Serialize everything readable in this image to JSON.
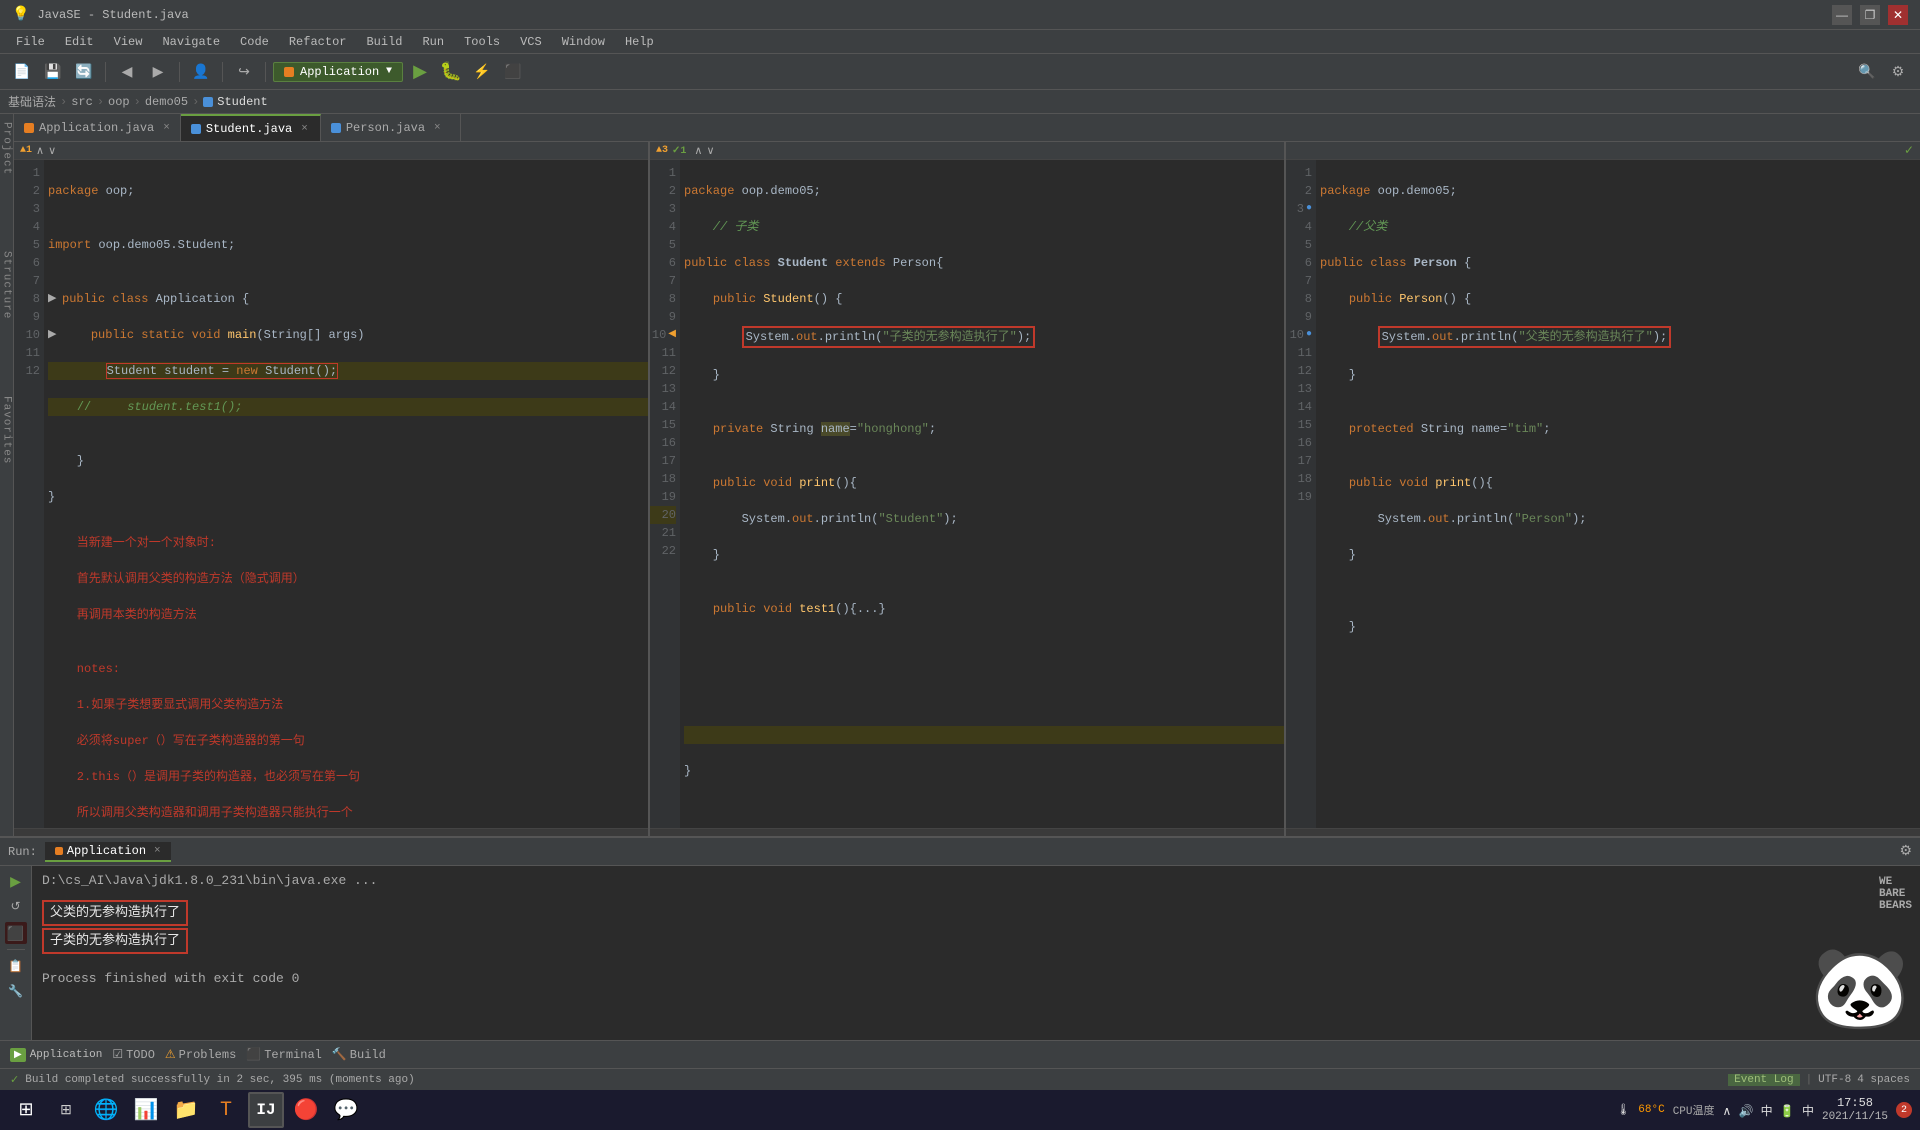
{
  "titlebar": {
    "title": "JavaSE - Student.java",
    "min": "—",
    "max": "❐",
    "close": "✕"
  },
  "menubar": {
    "items": [
      "File",
      "Edit",
      "View",
      "Navigate",
      "Code",
      "Refactor",
      "Build",
      "Run",
      "Tools",
      "VCS",
      "Window",
      "Help"
    ]
  },
  "toolbar": {
    "run_config": "Application",
    "run_arrow": "▼"
  },
  "breadcrumb": {
    "items": [
      "基础语法",
      "src",
      "oop",
      "demo05",
      "Student"
    ]
  },
  "tabs": {
    "left": [
      {
        "label": "Application.java",
        "active": false,
        "icon": "orange"
      },
      {
        "label": "×",
        "close": true
      }
    ],
    "center": [
      {
        "label": "Student.java",
        "active": true,
        "icon": "blue"
      },
      {
        "label": "×",
        "close": true
      }
    ],
    "right": [
      {
        "label": "Person.java",
        "active": false,
        "icon": "blue"
      },
      {
        "label": "×",
        "close": true
      }
    ]
  },
  "panel1": {
    "warnings": "▲1",
    "arrows": "∧ ∨",
    "code": [
      {
        "ln": "1",
        "text": "package oop;",
        "class": ""
      },
      {
        "ln": "2",
        "text": "",
        "class": ""
      },
      {
        "ln": "3",
        "text": "import oop.demo05.Student;",
        "class": ""
      },
      {
        "ln": "4",
        "text": "",
        "class": ""
      },
      {
        "ln": "5",
        "text": "public class Application {",
        "class": ""
      },
      {
        "ln": "6",
        "text": "    public static void main(String[] args)",
        "class": ""
      },
      {
        "ln": "7",
        "text": "        Student student = new Student();",
        "class": "hl-yellow"
      },
      {
        "ln": "8",
        "text": "    //      student.test1();",
        "class": "hl-yellow"
      },
      {
        "ln": "9",
        "text": "",
        "class": ""
      },
      {
        "ln": "10",
        "text": "    }",
        "class": ""
      },
      {
        "ln": "11",
        "text": "}",
        "class": ""
      },
      {
        "ln": "12",
        "text": "    当新建一个对一个对象时:",
        "class": "red"
      },
      {
        "ln": "",
        "text": "    首先默认调用父类的构造方法（隐式调用）",
        "class": "red"
      },
      {
        "ln": "",
        "text": "    再调用本类的构造方法",
        "class": "red"
      },
      {
        "ln": "",
        "text": "",
        "class": ""
      },
      {
        "ln": "",
        "text": "    notes:",
        "class": "red"
      },
      {
        "ln": "",
        "text": "    1.如果子类想要显式调用父类构造方法",
        "class": "red"
      },
      {
        "ln": "",
        "text": "    必须将super（）写在子类构造器的第一句",
        "class": "red"
      },
      {
        "ln": "",
        "text": "    2.this（）是调用子类的构造器，也必须写在第一句",
        "class": "red"
      },
      {
        "ln": "",
        "text": "    所以调用父类构造器和调用子类构造器只能执行一个",
        "class": "red"
      }
    ]
  },
  "panel2": {
    "warnings": "▲3 ✓1",
    "code": [
      {
        "ln": "1",
        "text": "package oop.demo05;"
      },
      {
        "ln": "2",
        "text": "    // 子类"
      },
      {
        "ln": "3",
        "text": "public class Student extends Person{"
      },
      {
        "ln": "4",
        "text": "    public Student() {"
      },
      {
        "ln": "5",
        "text": "        System.out.println(\"子类的无参构造执行了\");",
        "box": true
      },
      {
        "ln": "6",
        "text": "    }"
      },
      {
        "ln": "7",
        "text": ""
      },
      {
        "ln": "8",
        "text": "    private String name=\"honghong\";"
      },
      {
        "ln": "9",
        "text": ""
      },
      {
        "ln": "10",
        "text": "    public void print(){"
      },
      {
        "ln": "11",
        "text": "        System.out.println(\"Student\");"
      },
      {
        "ln": "12",
        "text": "    }"
      },
      {
        "ln": "13",
        "text": ""
      },
      {
        "ln": "14",
        "text": "    public void test1(){...}"
      },
      {
        "ln": "15",
        "text": ""
      },
      {
        "ln": "16",
        "text": ""
      },
      {
        "ln": "17",
        "text": ""
      },
      {
        "ln": "18",
        "text": ""
      },
      {
        "ln": "19",
        "text": ""
      },
      {
        "ln": "20",
        "text": "",
        "hl": "hl-yellow"
      },
      {
        "ln": "21",
        "text": "}"
      },
      {
        "ln": "22",
        "text": ""
      }
    ]
  },
  "panel3": {
    "code": [
      {
        "ln": "1",
        "text": "package oop.demo05;"
      },
      {
        "ln": "2",
        "text": "    //父类"
      },
      {
        "ln": "3",
        "text": "public class Person {"
      },
      {
        "ln": "4",
        "text": "    public Person() {"
      },
      {
        "ln": "5",
        "text": "        System.out.println(\"父类的无参构造执行了\");",
        "box": true
      },
      {
        "ln": "6",
        "text": "    }"
      },
      {
        "ln": "7",
        "text": ""
      },
      {
        "ln": "8",
        "text": "    protected String name=\"tim\";"
      },
      {
        "ln": "9",
        "text": ""
      },
      {
        "ln": "10",
        "text": "    public void print(){"
      },
      {
        "ln": "11",
        "text": "        System.out.println(\"Person\");"
      },
      {
        "ln": "12",
        "text": "    }"
      },
      {
        "ln": "13",
        "text": ""
      },
      {
        "ln": "14",
        "text": ""
      },
      {
        "ln": "15",
        "text": "    }"
      },
      {
        "ln": "16",
        "text": ""
      },
      {
        "ln": "17",
        "text": ""
      },
      {
        "ln": "18",
        "text": ""
      },
      {
        "ln": "19",
        "text": ""
      }
    ]
  },
  "run_panel": {
    "label": "Run:",
    "tab": "Application",
    "close": "×",
    "cmd": "D:\\cs_AI\\Java\\jdk1.8.0_231\\bin\\java.exe ...",
    "output1": "父类的无参构造执行了",
    "output2": "子类的无参构造执行了",
    "finish": "Process finished with exit code 0"
  },
  "status_bar": {
    "build_msg": "Build completed successfully in 2 sec, 395 ms (moments ago)",
    "event_log": "Event Log",
    "encoding": "UTF-8",
    "indent": "4 spaces",
    "line_info": ""
  },
  "taskbar": {
    "time": "17:58",
    "date": "2021/11/15",
    "temp": "68°C",
    "temp_label": "CPU温度"
  },
  "sidebar_labels": [
    "Project",
    "Structure",
    "Favorites"
  ],
  "icons": {
    "search": "🔍",
    "settings": "⚙",
    "run": "▶",
    "debug": "🐛",
    "build": "🔨",
    "stop": "⬛",
    "up": "∧",
    "down": "∨"
  }
}
